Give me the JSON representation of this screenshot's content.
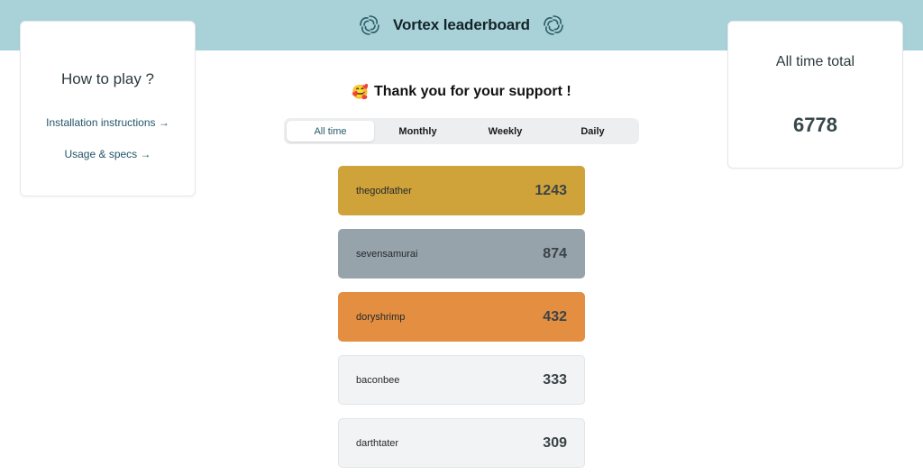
{
  "header": {
    "title": "Vortex leaderboard",
    "left_icon": "vortex-swirl-icon",
    "right_icon": "vortex-swirl-icon",
    "bg_color": "#a8d1d8"
  },
  "how_to_play": {
    "title": "How to play ?",
    "links": [
      {
        "label": "Installation instructions →"
      },
      {
        "label": "Usage & specs →"
      }
    ]
  },
  "all_time_total": {
    "title": "All time total",
    "value": "6778"
  },
  "thanks": {
    "emoji": "🥰",
    "text": "Thank you for your support !"
  },
  "tabs": [
    {
      "label": "All time",
      "active": true
    },
    {
      "label": "Monthly",
      "active": false
    },
    {
      "label": "Weekly",
      "active": false
    },
    {
      "label": "Daily",
      "active": false
    }
  ],
  "leaderboard": [
    {
      "name": "thegodfather",
      "score": "1243",
      "color": "#cfa23a"
    },
    {
      "name": "sevensamurai",
      "score": "874",
      "color": "#97a3ab"
    },
    {
      "name": "doryshrimp",
      "score": "432",
      "color": "#e38e41"
    },
    {
      "name": "baconbee",
      "score": "333",
      "color": "#f2f3f4"
    },
    {
      "name": "darthtater",
      "score": "309",
      "color": "#f2f3f4"
    }
  ]
}
